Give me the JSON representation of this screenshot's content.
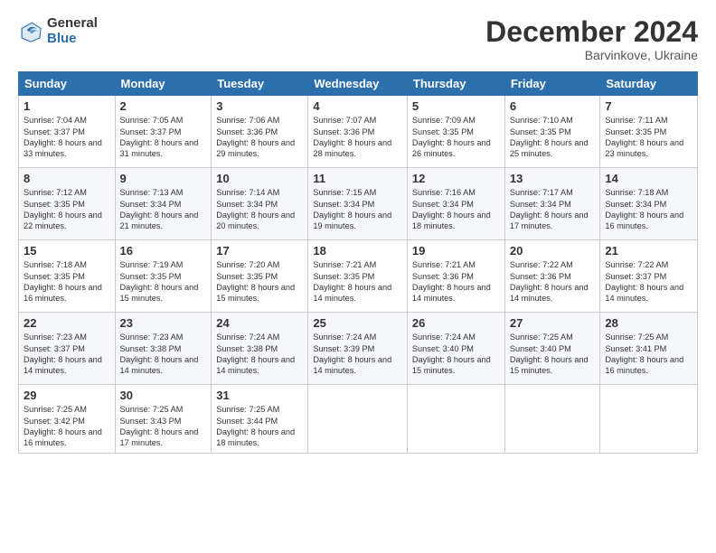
{
  "logo": {
    "general": "General",
    "blue": "Blue"
  },
  "header": {
    "month": "December 2024",
    "location": "Barvinkove, Ukraine"
  },
  "days_of_week": [
    "Sunday",
    "Monday",
    "Tuesday",
    "Wednesday",
    "Thursday",
    "Friday",
    "Saturday"
  ],
  "weeks": [
    [
      {
        "day": "1",
        "sunrise": "7:04 AM",
        "sunset": "3:37 PM",
        "daylight": "8 hours and 33 minutes."
      },
      {
        "day": "2",
        "sunrise": "7:05 AM",
        "sunset": "3:37 PM",
        "daylight": "8 hours and 31 minutes."
      },
      {
        "day": "3",
        "sunrise": "7:06 AM",
        "sunset": "3:36 PM",
        "daylight": "8 hours and 29 minutes."
      },
      {
        "day": "4",
        "sunrise": "7:07 AM",
        "sunset": "3:36 PM",
        "daylight": "8 hours and 28 minutes."
      },
      {
        "day": "5",
        "sunrise": "7:09 AM",
        "sunset": "3:35 PM",
        "daylight": "8 hours and 26 minutes."
      },
      {
        "day": "6",
        "sunrise": "7:10 AM",
        "sunset": "3:35 PM",
        "daylight": "8 hours and 25 minutes."
      },
      {
        "day": "7",
        "sunrise": "7:11 AM",
        "sunset": "3:35 PM",
        "daylight": "8 hours and 23 minutes."
      }
    ],
    [
      {
        "day": "8",
        "sunrise": "7:12 AM",
        "sunset": "3:35 PM",
        "daylight": "8 hours and 22 minutes."
      },
      {
        "day": "9",
        "sunrise": "7:13 AM",
        "sunset": "3:34 PM",
        "daylight": "8 hours and 21 minutes."
      },
      {
        "day": "10",
        "sunrise": "7:14 AM",
        "sunset": "3:34 PM",
        "daylight": "8 hours and 20 minutes."
      },
      {
        "day": "11",
        "sunrise": "7:15 AM",
        "sunset": "3:34 PM",
        "daylight": "8 hours and 19 minutes."
      },
      {
        "day": "12",
        "sunrise": "7:16 AM",
        "sunset": "3:34 PM",
        "daylight": "8 hours and 18 minutes."
      },
      {
        "day": "13",
        "sunrise": "7:17 AM",
        "sunset": "3:34 PM",
        "daylight": "8 hours and 17 minutes."
      },
      {
        "day": "14",
        "sunrise": "7:18 AM",
        "sunset": "3:34 PM",
        "daylight": "8 hours and 16 minutes."
      }
    ],
    [
      {
        "day": "15",
        "sunrise": "7:18 AM",
        "sunset": "3:35 PM",
        "daylight": "8 hours and 16 minutes."
      },
      {
        "day": "16",
        "sunrise": "7:19 AM",
        "sunset": "3:35 PM",
        "daylight": "8 hours and 15 minutes."
      },
      {
        "day": "17",
        "sunrise": "7:20 AM",
        "sunset": "3:35 PM",
        "daylight": "8 hours and 15 minutes."
      },
      {
        "day": "18",
        "sunrise": "7:21 AM",
        "sunset": "3:35 PM",
        "daylight": "8 hours and 14 minutes."
      },
      {
        "day": "19",
        "sunrise": "7:21 AM",
        "sunset": "3:36 PM",
        "daylight": "8 hours and 14 minutes."
      },
      {
        "day": "20",
        "sunrise": "7:22 AM",
        "sunset": "3:36 PM",
        "daylight": "8 hours and 14 minutes."
      },
      {
        "day": "21",
        "sunrise": "7:22 AM",
        "sunset": "3:37 PM",
        "daylight": "8 hours and 14 minutes."
      }
    ],
    [
      {
        "day": "22",
        "sunrise": "7:23 AM",
        "sunset": "3:37 PM",
        "daylight": "8 hours and 14 minutes."
      },
      {
        "day": "23",
        "sunrise": "7:23 AM",
        "sunset": "3:38 PM",
        "daylight": "8 hours and 14 minutes."
      },
      {
        "day": "24",
        "sunrise": "7:24 AM",
        "sunset": "3:38 PM",
        "daylight": "8 hours and 14 minutes."
      },
      {
        "day": "25",
        "sunrise": "7:24 AM",
        "sunset": "3:39 PM",
        "daylight": "8 hours and 14 minutes."
      },
      {
        "day": "26",
        "sunrise": "7:24 AM",
        "sunset": "3:40 PM",
        "daylight": "8 hours and 15 minutes."
      },
      {
        "day": "27",
        "sunrise": "7:25 AM",
        "sunset": "3:40 PM",
        "daylight": "8 hours and 15 minutes."
      },
      {
        "day": "28",
        "sunrise": "7:25 AM",
        "sunset": "3:41 PM",
        "daylight": "8 hours and 16 minutes."
      }
    ],
    [
      {
        "day": "29",
        "sunrise": "7:25 AM",
        "sunset": "3:42 PM",
        "daylight": "8 hours and 16 minutes."
      },
      {
        "day": "30",
        "sunrise": "7:25 AM",
        "sunset": "3:43 PM",
        "daylight": "8 hours and 17 minutes."
      },
      {
        "day": "31",
        "sunrise": "7:25 AM",
        "sunset": "3:44 PM",
        "daylight": "8 hours and 18 minutes."
      },
      null,
      null,
      null,
      null
    ]
  ]
}
